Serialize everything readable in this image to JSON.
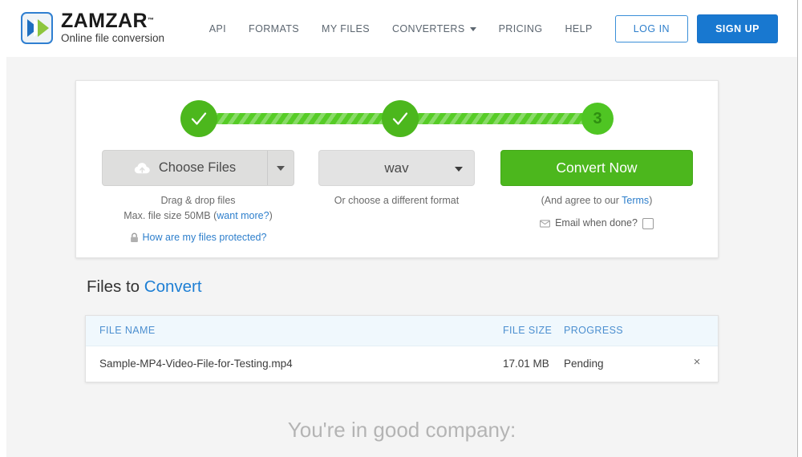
{
  "header": {
    "logo": {
      "name": "ZAMZAR",
      "tm": "™",
      "tagline": "Online file conversion",
      "icon": "zamzar-chevrons-icon"
    },
    "nav": [
      {
        "label": "API",
        "name": "nav-api"
      },
      {
        "label": "FORMATS",
        "name": "nav-formats"
      },
      {
        "label": "MY FILES",
        "name": "nav-my-files"
      },
      {
        "label": "CONVERTERS",
        "name": "nav-converters",
        "has_caret": true
      },
      {
        "label": "PRICING",
        "name": "nav-pricing"
      },
      {
        "label": "HELP",
        "name": "nav-help"
      }
    ],
    "login_label": "LOG IN",
    "signup_label": "SIGN UP"
  },
  "converter": {
    "steps": [
      {
        "state": "done",
        "glyph": "check"
      },
      {
        "state": "done",
        "glyph": "check"
      },
      {
        "state": "current",
        "label": "3"
      }
    ],
    "choose_files_label": "Choose Files",
    "choose_files_icon": "cloud-upload-icon",
    "format_value": "wav",
    "convert_label": "Convert Now",
    "helper_left_line1": "Drag & drop files",
    "helper_left_line2_prefix": "Max. file size 50MB (",
    "helper_left_link": "want more?",
    "helper_left_line2_suffix": ")",
    "protected_link": "How are my files protected?",
    "protected_icon": "lock-icon",
    "helper_mid": "Or choose a different format",
    "terms_prefix": "(And agree to our ",
    "terms_link": "Terms",
    "terms_suffix": ")",
    "email_label": "Email when done?",
    "email_icon": "envelope-icon",
    "email_checked": false
  },
  "files_section": {
    "heading_prefix": "Files to ",
    "heading_accent": "Convert",
    "columns": {
      "name": "FILE NAME",
      "size": "FILE SIZE",
      "progress": "PROGRESS"
    },
    "rows": [
      {
        "name": "Sample-MP4-Video-File-for-Testing.mp4",
        "size": "17.01 MB",
        "progress": "Pending",
        "remove": "×"
      }
    ]
  },
  "footer": {
    "good_company": "You're in good company:"
  },
  "colors": {
    "brand_blue": "#1878d0",
    "link_blue": "#2e7fcc",
    "green": "#4cb71d",
    "green_light": "#4fc523",
    "page_bg": "#f4f4f4",
    "table_head_bg": "#f0f8fd"
  }
}
